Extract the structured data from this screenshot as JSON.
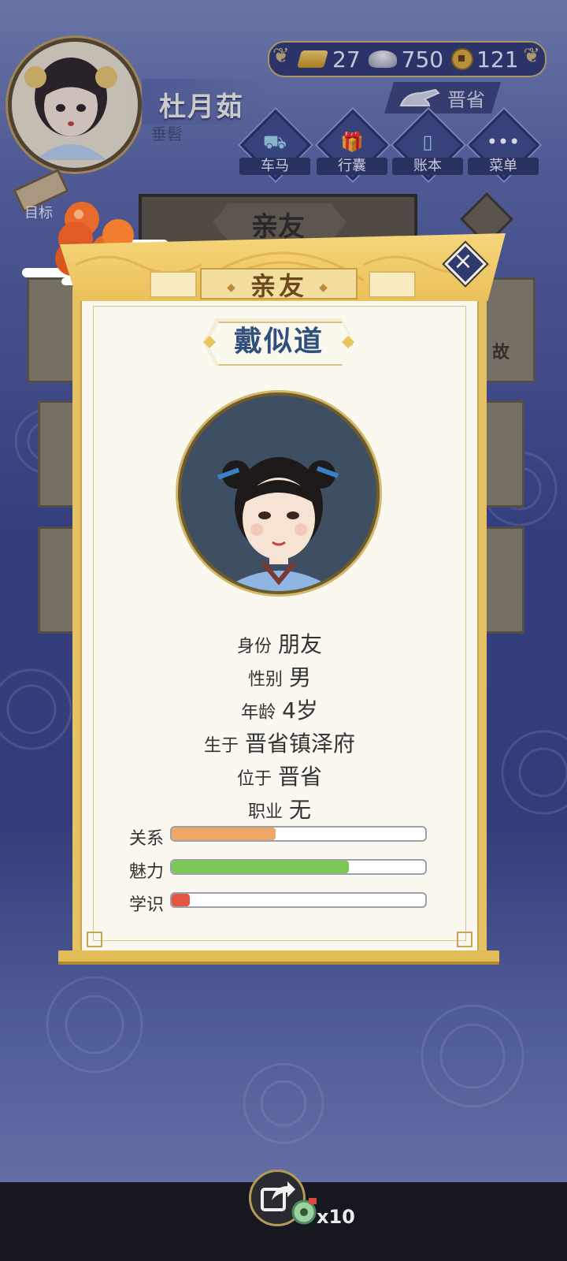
{
  "player": {
    "name": "杜月茹",
    "title": "垂髫"
  },
  "currency": {
    "gold": "27",
    "silver": "750",
    "coins": "121"
  },
  "region": {
    "label": "晋省"
  },
  "hud_buttons": [
    {
      "label": "车马",
      "icon": "carriage-icon"
    },
    {
      "label": "行囊",
      "icon": "bundle-icon"
    },
    {
      "label": "账本",
      "icon": "ledger-icon"
    },
    {
      "label": "菜单",
      "icon": "menu-dots-icon"
    }
  ],
  "target_button": {
    "label": "目标"
  },
  "back_window": {
    "title": "亲友",
    "card_text": "故"
  },
  "dialog": {
    "title": "亲友",
    "npc_name": "戴似道",
    "info": [
      {
        "key": "身份",
        "value": "朋友"
      },
      {
        "key": "性别",
        "value": "男"
      },
      {
        "key": "年龄",
        "value": "4岁"
      },
      {
        "key": "生于",
        "value": "晋省镇泽府"
      },
      {
        "key": "位于",
        "value": "晋省"
      },
      {
        "key": "职业",
        "value": "无"
      }
    ],
    "stats": [
      {
        "label": "关系",
        "fraction": 0.41,
        "color": "#eda866"
      },
      {
        "label": "魅力",
        "fraction": 0.7,
        "color": "#7ac657"
      },
      {
        "label": "学识",
        "fraction": 0.07,
        "color": "#e05643"
      }
    ]
  },
  "share": {
    "multiplier": "x10"
  }
}
